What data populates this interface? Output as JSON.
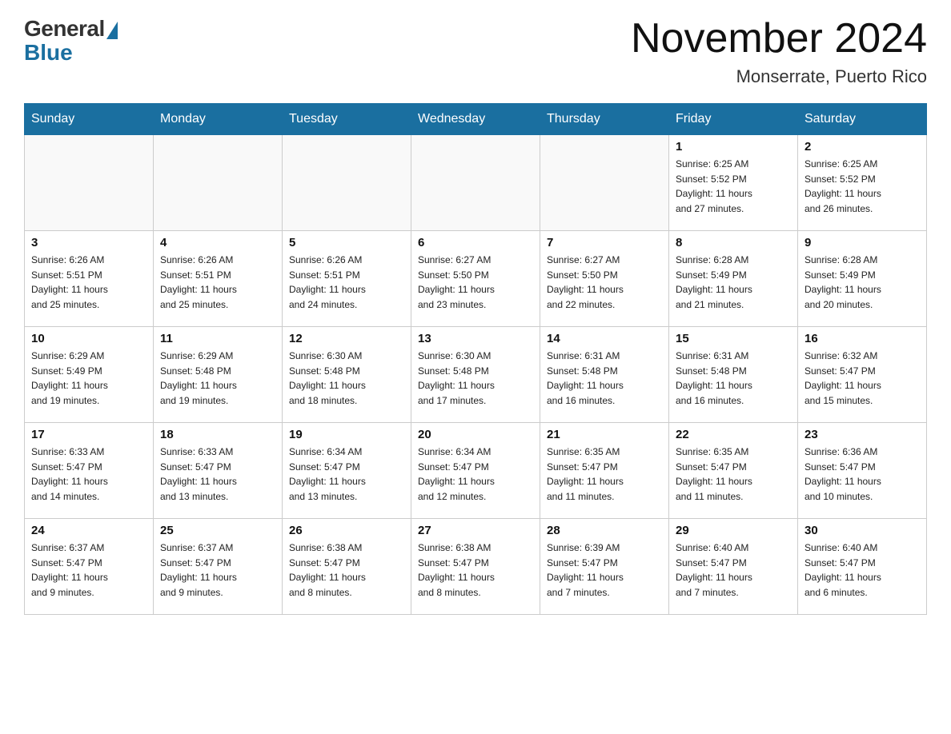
{
  "header": {
    "logo_general": "General",
    "logo_blue": "Blue",
    "month_title": "November 2024",
    "location": "Monserrate, Puerto Rico"
  },
  "weekdays": [
    "Sunday",
    "Monday",
    "Tuesday",
    "Wednesday",
    "Thursday",
    "Friday",
    "Saturday"
  ],
  "weeks": [
    [
      {
        "day": "",
        "info": ""
      },
      {
        "day": "",
        "info": ""
      },
      {
        "day": "",
        "info": ""
      },
      {
        "day": "",
        "info": ""
      },
      {
        "day": "",
        "info": ""
      },
      {
        "day": "1",
        "info": "Sunrise: 6:25 AM\nSunset: 5:52 PM\nDaylight: 11 hours\nand 27 minutes."
      },
      {
        "day": "2",
        "info": "Sunrise: 6:25 AM\nSunset: 5:52 PM\nDaylight: 11 hours\nand 26 minutes."
      }
    ],
    [
      {
        "day": "3",
        "info": "Sunrise: 6:26 AM\nSunset: 5:51 PM\nDaylight: 11 hours\nand 25 minutes."
      },
      {
        "day": "4",
        "info": "Sunrise: 6:26 AM\nSunset: 5:51 PM\nDaylight: 11 hours\nand 25 minutes."
      },
      {
        "day": "5",
        "info": "Sunrise: 6:26 AM\nSunset: 5:51 PM\nDaylight: 11 hours\nand 24 minutes."
      },
      {
        "day": "6",
        "info": "Sunrise: 6:27 AM\nSunset: 5:50 PM\nDaylight: 11 hours\nand 23 minutes."
      },
      {
        "day": "7",
        "info": "Sunrise: 6:27 AM\nSunset: 5:50 PM\nDaylight: 11 hours\nand 22 minutes."
      },
      {
        "day": "8",
        "info": "Sunrise: 6:28 AM\nSunset: 5:49 PM\nDaylight: 11 hours\nand 21 minutes."
      },
      {
        "day": "9",
        "info": "Sunrise: 6:28 AM\nSunset: 5:49 PM\nDaylight: 11 hours\nand 20 minutes."
      }
    ],
    [
      {
        "day": "10",
        "info": "Sunrise: 6:29 AM\nSunset: 5:49 PM\nDaylight: 11 hours\nand 19 minutes."
      },
      {
        "day": "11",
        "info": "Sunrise: 6:29 AM\nSunset: 5:48 PM\nDaylight: 11 hours\nand 19 minutes."
      },
      {
        "day": "12",
        "info": "Sunrise: 6:30 AM\nSunset: 5:48 PM\nDaylight: 11 hours\nand 18 minutes."
      },
      {
        "day": "13",
        "info": "Sunrise: 6:30 AM\nSunset: 5:48 PM\nDaylight: 11 hours\nand 17 minutes."
      },
      {
        "day": "14",
        "info": "Sunrise: 6:31 AM\nSunset: 5:48 PM\nDaylight: 11 hours\nand 16 minutes."
      },
      {
        "day": "15",
        "info": "Sunrise: 6:31 AM\nSunset: 5:48 PM\nDaylight: 11 hours\nand 16 minutes."
      },
      {
        "day": "16",
        "info": "Sunrise: 6:32 AM\nSunset: 5:47 PM\nDaylight: 11 hours\nand 15 minutes."
      }
    ],
    [
      {
        "day": "17",
        "info": "Sunrise: 6:33 AM\nSunset: 5:47 PM\nDaylight: 11 hours\nand 14 minutes."
      },
      {
        "day": "18",
        "info": "Sunrise: 6:33 AM\nSunset: 5:47 PM\nDaylight: 11 hours\nand 13 minutes."
      },
      {
        "day": "19",
        "info": "Sunrise: 6:34 AM\nSunset: 5:47 PM\nDaylight: 11 hours\nand 13 minutes."
      },
      {
        "day": "20",
        "info": "Sunrise: 6:34 AM\nSunset: 5:47 PM\nDaylight: 11 hours\nand 12 minutes."
      },
      {
        "day": "21",
        "info": "Sunrise: 6:35 AM\nSunset: 5:47 PM\nDaylight: 11 hours\nand 11 minutes."
      },
      {
        "day": "22",
        "info": "Sunrise: 6:35 AM\nSunset: 5:47 PM\nDaylight: 11 hours\nand 11 minutes."
      },
      {
        "day": "23",
        "info": "Sunrise: 6:36 AM\nSunset: 5:47 PM\nDaylight: 11 hours\nand 10 minutes."
      }
    ],
    [
      {
        "day": "24",
        "info": "Sunrise: 6:37 AM\nSunset: 5:47 PM\nDaylight: 11 hours\nand 9 minutes."
      },
      {
        "day": "25",
        "info": "Sunrise: 6:37 AM\nSunset: 5:47 PM\nDaylight: 11 hours\nand 9 minutes."
      },
      {
        "day": "26",
        "info": "Sunrise: 6:38 AM\nSunset: 5:47 PM\nDaylight: 11 hours\nand 8 minutes."
      },
      {
        "day": "27",
        "info": "Sunrise: 6:38 AM\nSunset: 5:47 PM\nDaylight: 11 hours\nand 8 minutes."
      },
      {
        "day": "28",
        "info": "Sunrise: 6:39 AM\nSunset: 5:47 PM\nDaylight: 11 hours\nand 7 minutes."
      },
      {
        "day": "29",
        "info": "Sunrise: 6:40 AM\nSunset: 5:47 PM\nDaylight: 11 hours\nand 7 minutes."
      },
      {
        "day": "30",
        "info": "Sunrise: 6:40 AM\nSunset: 5:47 PM\nDaylight: 11 hours\nand 6 minutes."
      }
    ]
  ]
}
